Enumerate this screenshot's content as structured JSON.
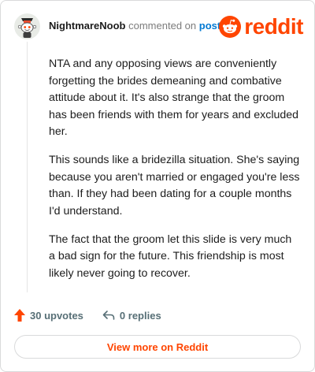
{
  "comment": {
    "username": "NightmareNoob",
    "verb": "commented on",
    "target": "post",
    "paragraphs": [
      "NTA and any opposing views are conveniently forgetting the brides demeaning and combative attitude about it. It's also strange that the groom has been friends with them for years and excluded her.",
      "This sounds like a bridezilla situation. She's saying because you aren't married or engaged you're less than. If they had been dating for a couple months I'd understand.",
      "The fact that the groom let this slide is very much a bad sign for the future. This friendship is most likely never going to recover."
    ]
  },
  "brand": {
    "wordmark": "reddit",
    "color": "#ff4500"
  },
  "actions": {
    "upvotes": "30 upvotes",
    "replies": "0 replies"
  },
  "footer": {
    "button_label": "View more on Reddit"
  }
}
